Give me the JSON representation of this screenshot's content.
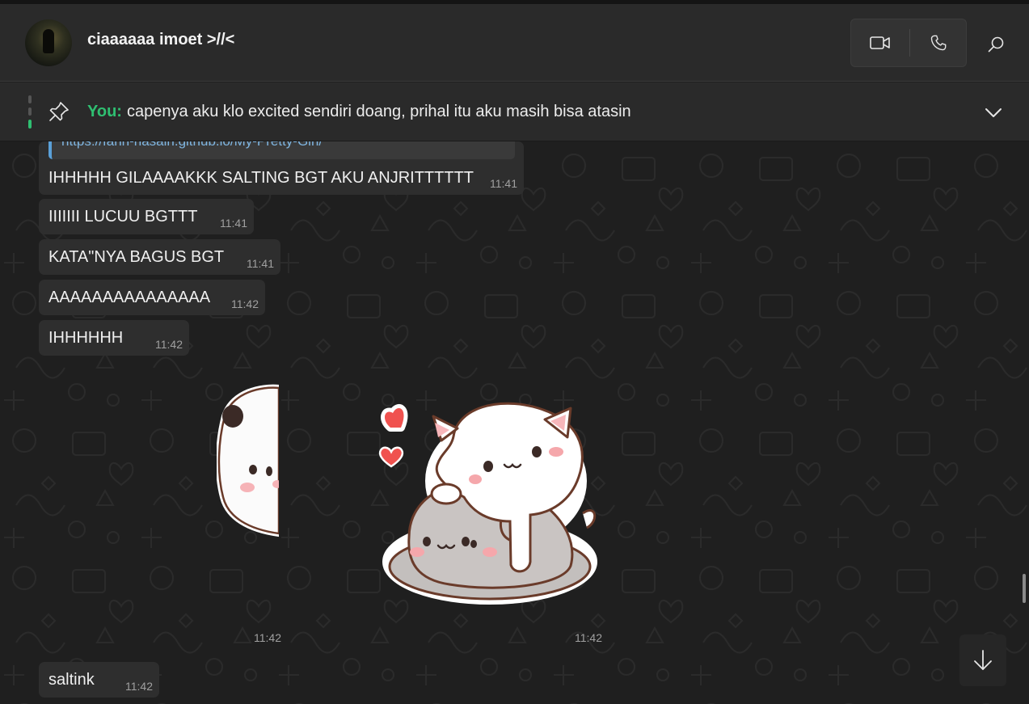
{
  "header": {
    "contact_name": "ciaaaaaa imoet >//<",
    "icons": [
      "video-call-icon",
      "voice-call-icon",
      "search-icon"
    ]
  },
  "pinned": {
    "sender": "You:",
    "text": "capenya aku klo excited sendiri doang, prihal itu aku masih bisa atasin",
    "accent_color": "#2fbf71"
  },
  "messages": [
    {
      "link_partial": "https://fahri-hasain.github.io/My-Pretty-Girl/",
      "text": "IHHHHH GILAAAAKKK SALTING BGT AKU ANJRITTTTTT",
      "time": "11:41"
    },
    {
      "text": "IIIIIII LUCUU BGTTT",
      "time": "11:41"
    },
    {
      "text": "KATA\"NYA BAGUS BGT",
      "time": "11:41"
    },
    {
      "text": "AAAAAAAAAAAAAAA",
      "time": "11:42"
    },
    {
      "text": "IHHHHHH",
      "time": "11:42"
    }
  ],
  "stickers": [
    {
      "name": "peeking-panda-sticker",
      "time": "11:42"
    },
    {
      "name": "cats-cuddling-sticker",
      "time": "11:42"
    }
  ],
  "last_message": {
    "text": "saltink",
    "time": "11:42"
  },
  "colors": {
    "background": "#1f1f1f",
    "header": "#2a2a2a",
    "bubble": "#2e2e2e",
    "accent": "#2fbf71"
  }
}
